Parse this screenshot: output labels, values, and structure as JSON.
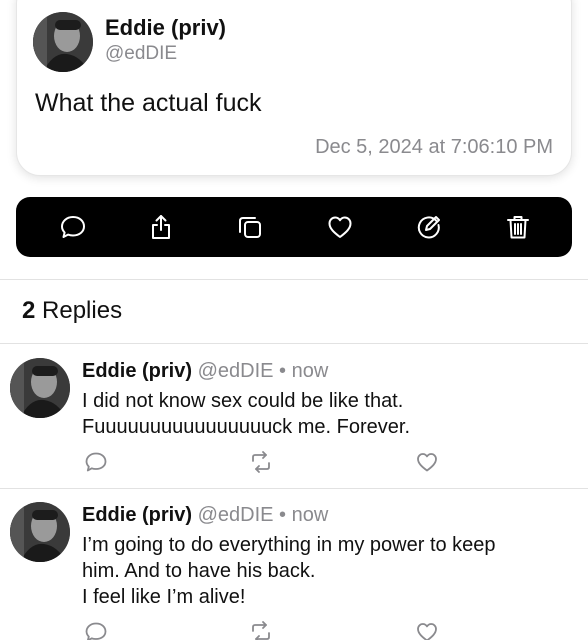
{
  "post": {
    "author_name": "Eddie (priv)",
    "author_handle": "@edDIE",
    "text": "What the actual fuck",
    "timestamp": "Dec 5, 2024 at 7:06:10 PM",
    "avatar_icon": "avatar-photo"
  },
  "action_bar": {
    "background": "#000000",
    "icons": [
      "speech-bubble-icon",
      "share-icon",
      "copy-icon",
      "heart-icon",
      "compose-icon",
      "trash-icon"
    ]
  },
  "replies_header": {
    "count": "2",
    "label": "Replies"
  },
  "replies": [
    {
      "author_name": "Eddie (priv)",
      "author_handle": "@edDIE",
      "separator": "•",
      "time": "now",
      "lines": [
        "I did not know sex could be like that.",
        "Fuuuuuuuuuuuuuuuuck me. Forever."
      ]
    },
    {
      "author_name": "Eddie (priv)",
      "author_handle": "@edDIE",
      "separator": "•",
      "time": "now",
      "lines": [
        "I’m going to do everything in my power to keep",
        "him. And to have his back.",
        "I feel like I’m alive!"
      ]
    }
  ],
  "colors": {
    "secondary_text": "#8a8a8e",
    "divider": "#e2e2e2"
  }
}
